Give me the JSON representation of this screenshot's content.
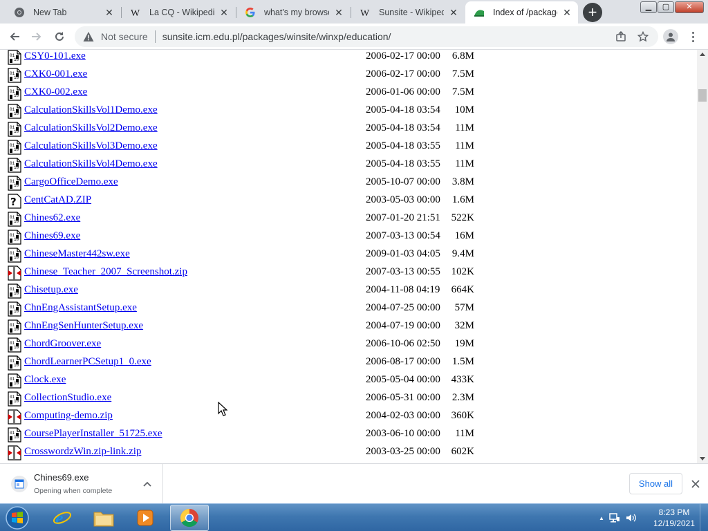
{
  "browser": {
    "tabs": [
      {
        "title": "New Tab",
        "icon": "chrome-icon"
      },
      {
        "title": "La CQ - Wikipedia",
        "icon": "wikipedia-icon"
      },
      {
        "title": "what's my browser",
        "icon": "google-icon"
      },
      {
        "title": "Sunsite - Wikipedia",
        "icon": "wikipedia-icon"
      },
      {
        "title": "Index of /packages",
        "icon": "sunsite-icon"
      }
    ],
    "active_tab": 4,
    "close_glyph": "✕",
    "new_tab_glyph": "+",
    "window_controls": {
      "minimize": "▁",
      "maximize": "▢",
      "close": "✕"
    },
    "omnibox": {
      "security_text": "Not secure",
      "url": "sunsite.icm.edu.pl/packages/winsite/winxp/education/"
    }
  },
  "listing": {
    "rows": [
      {
        "name": "CSY0-101.exe",
        "date": "2006-02-17 00:00",
        "size": "6.8M",
        "type": "binary"
      },
      {
        "name": "CXK0-001.exe",
        "date": "2006-02-17 00:00",
        "size": "7.5M",
        "type": "binary"
      },
      {
        "name": "CXK0-002.exe",
        "date": "2006-01-06 00:00",
        "size": "7.5M",
        "type": "binary"
      },
      {
        "name": "CalculationSkillsVol1Demo.exe",
        "date": "2005-04-18 03:54",
        "size": "10M",
        "type": "binary"
      },
      {
        "name": "CalculationSkillsVol2Demo.exe",
        "date": "2005-04-18 03:54",
        "size": "11M",
        "type": "binary"
      },
      {
        "name": "CalculationSkillsVol3Demo.exe",
        "date": "2005-04-18 03:55",
        "size": "11M",
        "type": "binary"
      },
      {
        "name": "CalculationSkillsVol4Demo.exe",
        "date": "2005-04-18 03:55",
        "size": "11M",
        "type": "binary"
      },
      {
        "name": "CargoOfficeDemo.exe",
        "date": "2005-10-07 00:00",
        "size": "3.8M",
        "type": "binary"
      },
      {
        "name": "CentCatAD.ZIP",
        "date": "2003-05-03 00:00",
        "size": "1.6M",
        "type": "unknown"
      },
      {
        "name": "Chines62.exe",
        "date": "2007-01-20 21:51",
        "size": "522K",
        "type": "binary"
      },
      {
        "name": "Chines69.exe",
        "date": "2007-03-13 00:54",
        "size": "16M",
        "type": "binary"
      },
      {
        "name": "ChineseMaster442sw.exe",
        "date": "2009-01-03 04:05",
        "size": "9.4M",
        "type": "binary"
      },
      {
        "name": "Chinese_Teacher_2007_Screenshot.zip",
        "date": "2007-03-13 00:55",
        "size": "102K",
        "type": "compressed"
      },
      {
        "name": "Chisetup.exe",
        "date": "2004-11-08 04:19",
        "size": "664K",
        "type": "binary"
      },
      {
        "name": "ChnEngAssistantSetup.exe",
        "date": "2004-07-25 00:00",
        "size": "57M",
        "type": "binary"
      },
      {
        "name": "ChnEngSenHunterSetup.exe",
        "date": "2004-07-19 00:00",
        "size": "32M",
        "type": "binary"
      },
      {
        "name": "ChordGroover.exe",
        "date": "2006-10-06 02:50",
        "size": "19M",
        "type": "binary"
      },
      {
        "name": "ChordLearnerPCSetup1_0.exe",
        "date": "2006-08-17 00:00",
        "size": "1.5M",
        "type": "binary"
      },
      {
        "name": "Clock.exe",
        "date": "2005-05-04 00:00",
        "size": "433K",
        "type": "binary"
      },
      {
        "name": "CollectionStudio.exe",
        "date": "2006-05-31 00:00",
        "size": "2.3M",
        "type": "binary"
      },
      {
        "name": "Computing-demo.zip",
        "date": "2004-02-03 00:00",
        "size": "360K",
        "type": "compressed"
      },
      {
        "name": "CoursePlayerInstaller_51725.exe",
        "date": "2003-06-10 00:00",
        "size": "11M",
        "type": "binary"
      },
      {
        "name": "CrosswordzWin.zip-link.zip",
        "date": "2003-03-25 00:00",
        "size": "602K",
        "type": "compressed"
      }
    ]
  },
  "download_shelf": {
    "file_name": "Chines69.exe",
    "status": "Opening when complete",
    "show_all_label": "Show all"
  },
  "taskbar": {
    "apps": [
      "internet-explorer-icon",
      "file-explorer-icon",
      "media-player-icon",
      "chrome-icon"
    ],
    "active_app": "chrome-icon",
    "clock": {
      "time": "8:23 PM",
      "date": "12/19/2021"
    },
    "tray_arrow": "▲"
  },
  "colors": {
    "link": "#0000ee",
    "tabstrip": "#dee1e6",
    "taskbar": "#3f77b0",
    "show_all": "#1a73e8"
  }
}
